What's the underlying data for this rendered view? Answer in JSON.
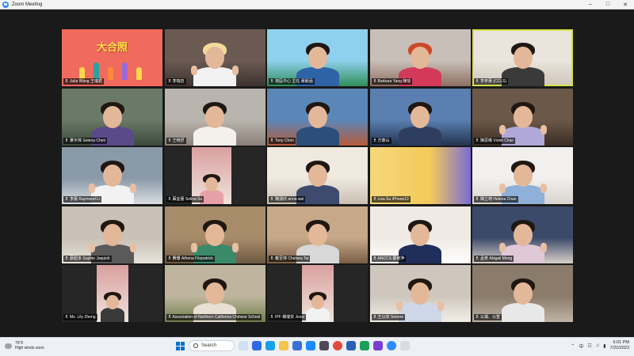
{
  "window": {
    "title": "Zoom Meeting"
  },
  "tiles": [
    {
      "name": "Julia Wang 王瑞君",
      "kind": "title-card",
      "card_text": "大合照"
    },
    {
      "name": "李瑞亞"
    },
    {
      "name": "灣區中心 主任 蔣穎涵"
    },
    {
      "name": "Barbara Yang 陳琰"
    },
    {
      "name": "李寧惠 (CCLS)",
      "active": true
    },
    {
      "name": "粟宇煒 Selena Chen"
    },
    {
      "name": "王曉舒"
    },
    {
      "name": "Tony Chen"
    },
    {
      "name": "方泰山"
    },
    {
      "name": "陳思琳 Violet Chan"
    },
    {
      "name": "李蕾 Raymond Li"
    },
    {
      "name": "蘇宜蕾 Selina Su"
    },
    {
      "name": "魏湧欣 anna wei"
    },
    {
      "name": "Lisa Su iPhone13"
    },
    {
      "name": "陳立琦 Helena Chan"
    },
    {
      "name": "蔡韶多 Sophie Jaquish"
    },
    {
      "name": "費珊 Athena Fitzpatrick"
    },
    {
      "name": "戴至瑋 Chelsea Tai"
    },
    {
      "name": "ANCCS 鄭敏萍"
    },
    {
      "name": "孟奇 Abigail Meng"
    },
    {
      "name": "Ms. Lily Zheng"
    },
    {
      "name": "Association of Northern California Chinese School"
    },
    {
      "name": "IPF 楊瑞安 Jessi"
    },
    {
      "name": "王以欣 Serene"
    },
    {
      "name": "以凝、以萱"
    }
  ],
  "taskbar": {
    "weather_temp": "75°F",
    "weather_desc": "High winds soon",
    "search_label": "Search",
    "tray_lang": "中",
    "time": "6:01 PM",
    "date": "7/22/2023"
  }
}
